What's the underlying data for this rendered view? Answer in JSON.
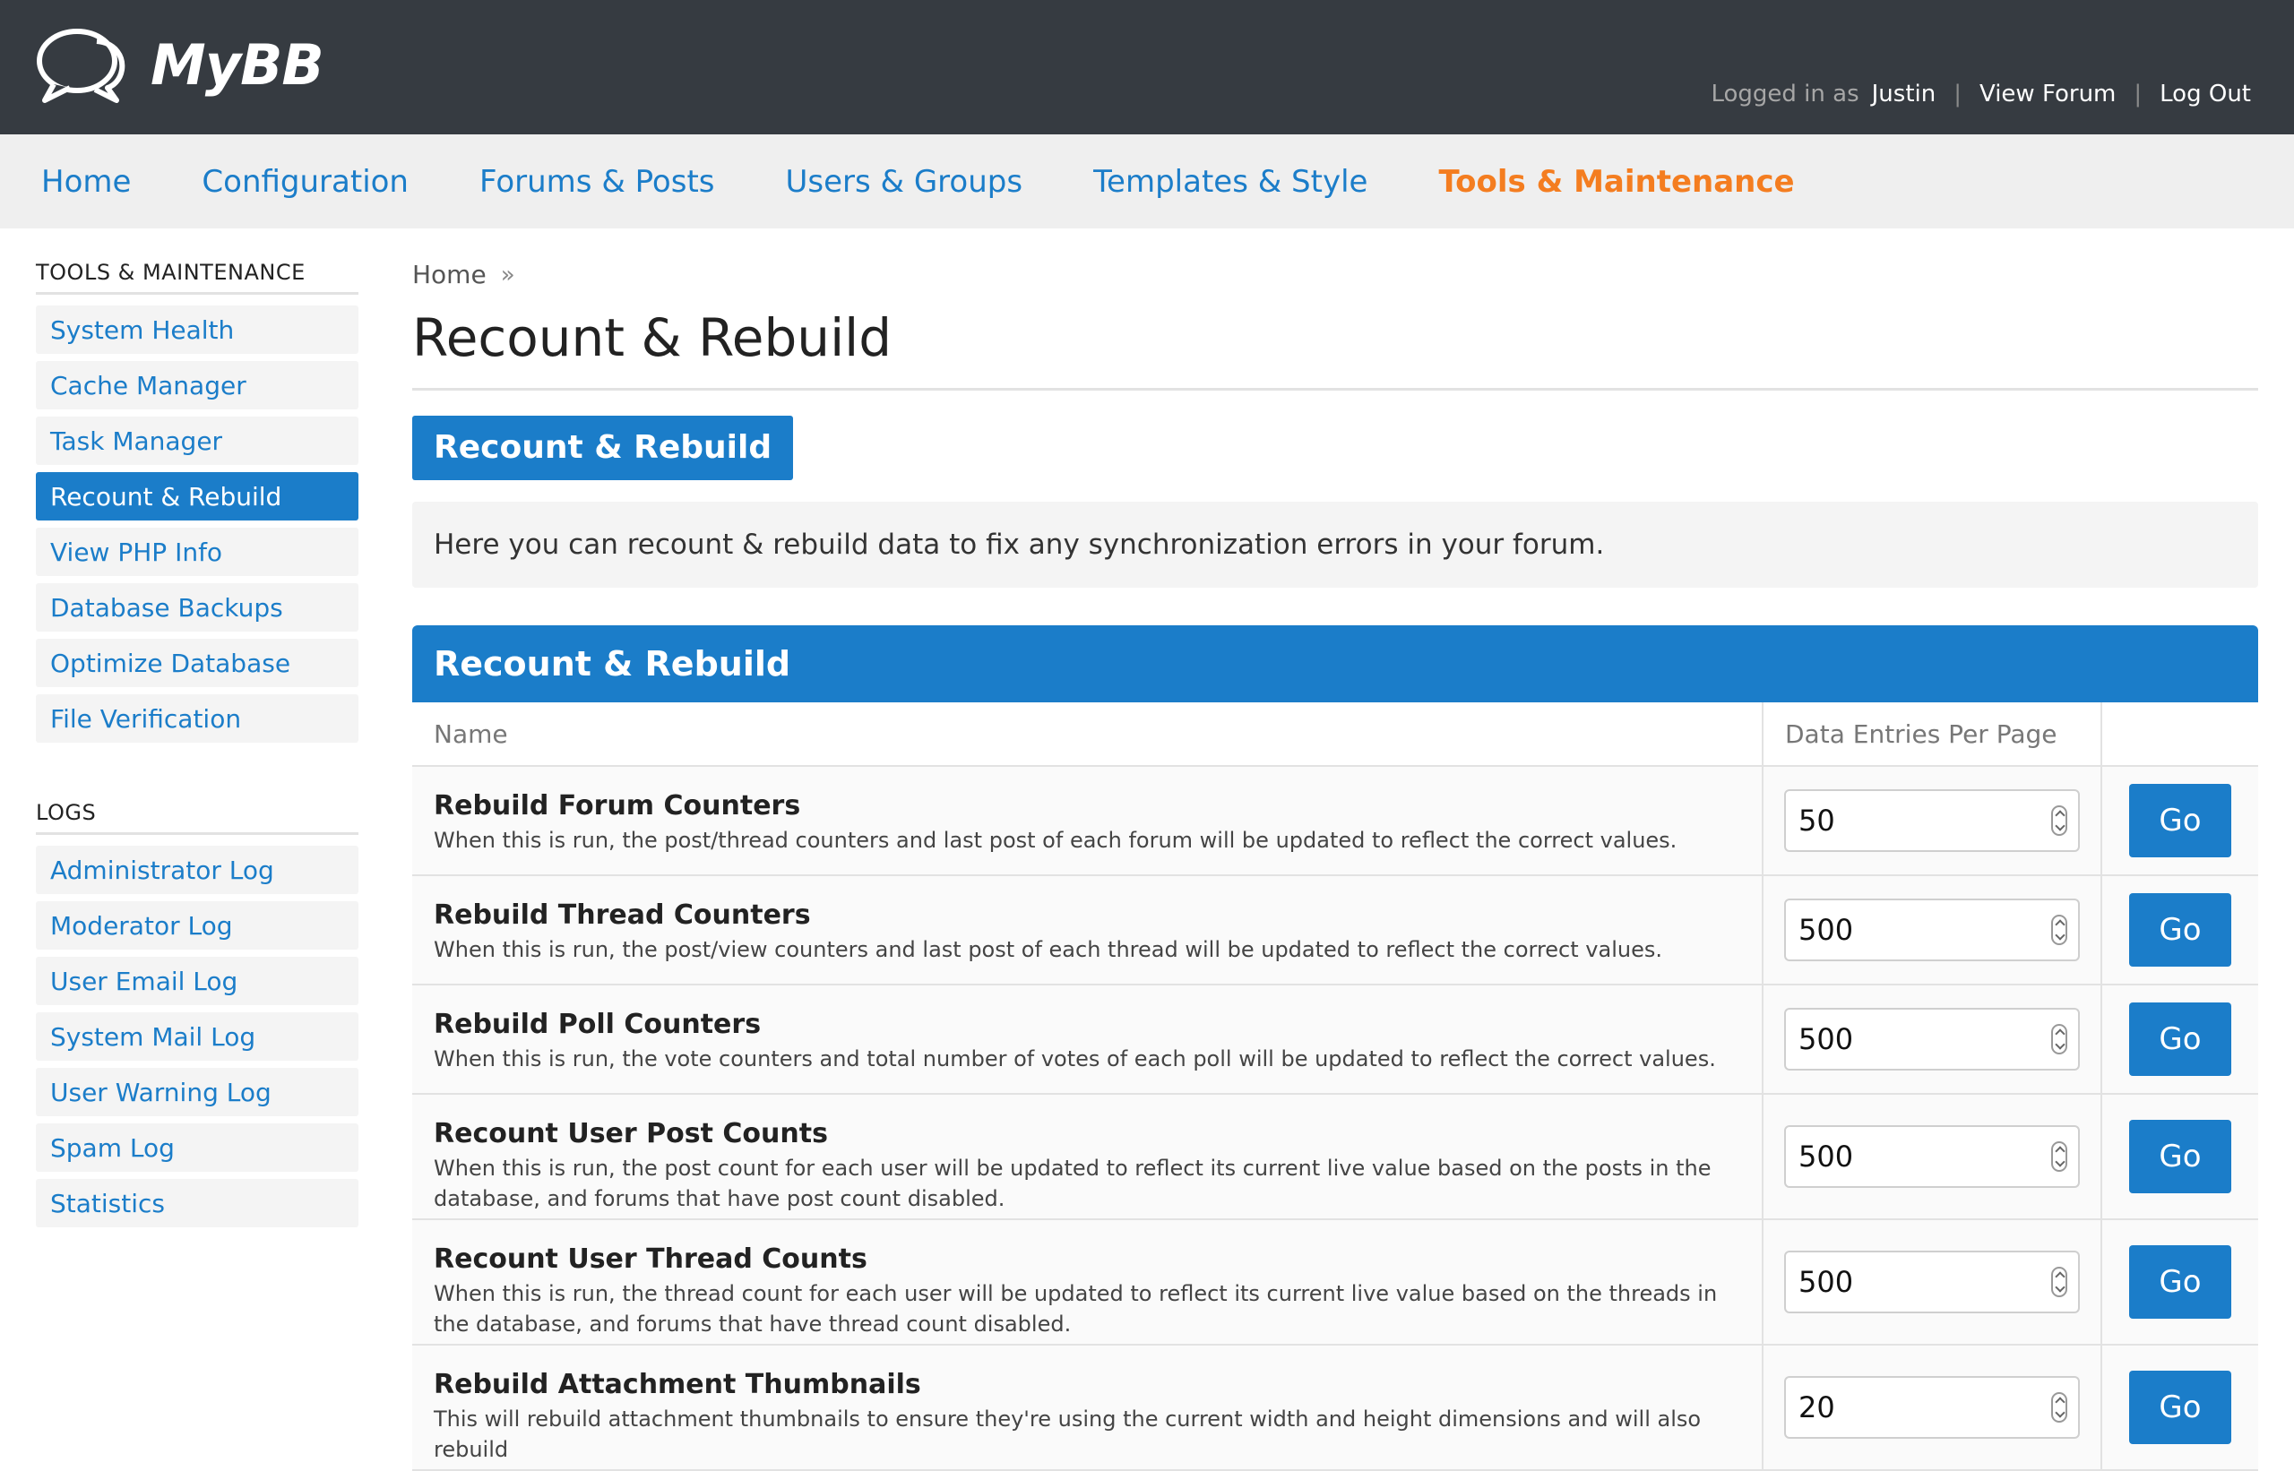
{
  "header": {
    "brand": "MyBB",
    "logged_in_label": "Logged in as",
    "username": "Justin",
    "separator": "|",
    "view_forum": "View Forum",
    "log_out": "Log Out"
  },
  "topnav": {
    "items": [
      "Home",
      "Configuration",
      "Forums & Posts",
      "Users & Groups",
      "Templates & Style",
      "Tools & Maintenance"
    ],
    "active_index": 5
  },
  "sidebar": {
    "tools_heading": "TOOLS & MAINTENANCE",
    "tools_items": [
      "System Health",
      "Cache Manager",
      "Task Manager",
      "Recount & Rebuild",
      "View PHP Info",
      "Database Backups",
      "Optimize Database",
      "File Verification"
    ],
    "tools_active_index": 3,
    "logs_heading": "LOGS",
    "logs_items": [
      "Administrator Log",
      "Moderator Log",
      "User Email Log",
      "System Mail Log",
      "User Warning Log",
      "Spam Log",
      "Statistics"
    ]
  },
  "main": {
    "breadcrumb": "Home",
    "breadcrumb_sep": "»",
    "title": "Recount & Rebuild",
    "tab_label": "Recount & Rebuild",
    "intro": "Here you can recount & rebuild data to fix any synchronization errors in your forum.",
    "table_title": "Recount & Rebuild",
    "col_name": "Name",
    "col_entries": "Data Entries Per Page",
    "go_label": "Go",
    "rows": [
      {
        "title": "Rebuild Forum Counters",
        "desc": "When this is run, the post/thread counters and last post of each forum will be updated to reflect the correct values.",
        "value": "50"
      },
      {
        "title": "Rebuild Thread Counters",
        "desc": "When this is run, the post/view counters and last post of each thread will be updated to reflect the correct values.",
        "value": "500"
      },
      {
        "title": "Rebuild Poll Counters",
        "desc": "When this is run, the vote counters and total number of votes of each poll will be updated to reflect the correct values.",
        "value": "500"
      },
      {
        "title": "Recount User Post Counts",
        "desc": "When this is run, the post count for each user will be updated to reflect its current live value based on the posts in the database, and forums that have post count disabled.",
        "value": "500"
      },
      {
        "title": "Recount User Thread Counts",
        "desc": "When this is run, the thread count for each user will be updated to reflect its current live value based on the threads in the database, and forums that have thread count disabled.",
        "value": "500"
      },
      {
        "title": "Rebuild Attachment Thumbnails",
        "desc": "This will rebuild attachment thumbnails to ensure they're using the current width and height dimensions and will also rebuild",
        "value": "20"
      }
    ]
  },
  "colors": {
    "header_bg": "#363b41",
    "accent_blue": "#1b7dc9",
    "active_orange": "#f47d20"
  }
}
